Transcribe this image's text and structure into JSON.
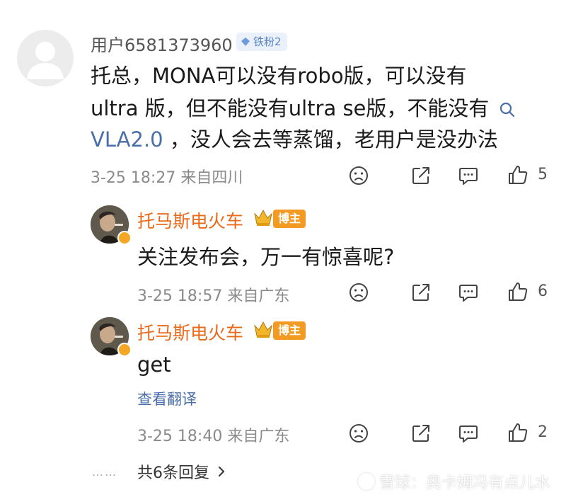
{
  "comment_main": {
    "username": "用户6581373960",
    "fan_badge": "铁粉2",
    "lines": [
      "托总，MONA可以没有robo版，可以没有",
      "ultra 版，但不能没有ultra se版，不能没有"
    ],
    "line3_link": "VLA2.0",
    "line3_rest": " ，没人会去等蒸馏，老用户是没办法",
    "meta": "3-25 18:27  来自四川",
    "likes": "5"
  },
  "reply1": {
    "username": "托马斯电火车",
    "tag": "博主",
    "text": "关注发布会，万一有惊喜呢?",
    "meta": "3-25 18:57  来自广东",
    "likes": "6"
  },
  "reply2": {
    "username": "托马斯电火车",
    "tag": "博主",
    "text": "get",
    "translate": "查看翻译",
    "meta": "3-25 18:40  来自广东",
    "likes": "2"
  },
  "more_replies": {
    "dots": "……",
    "label": "共6条回复"
  },
  "watermark": "雪球：奥卡姆冯有点儿水",
  "icons": {
    "dislike": "sad-face-icon",
    "share": "share-icon",
    "comment": "comment-icon",
    "like": "thumb-up-icon",
    "search": "search-icon",
    "chevron": "chevron-right-icon"
  }
}
